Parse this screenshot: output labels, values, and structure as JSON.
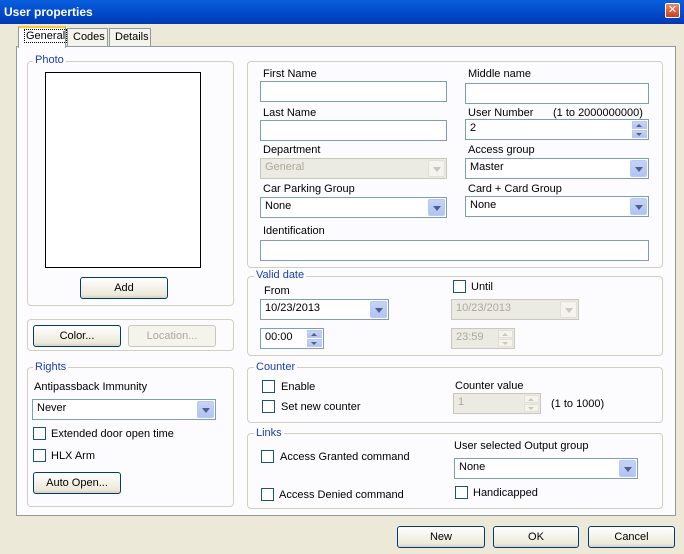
{
  "window": {
    "title": "User properties"
  },
  "tabs": [
    {
      "label": "General"
    },
    {
      "label": "Codes"
    },
    {
      "label": "Details"
    }
  ],
  "photo": {
    "group_label": "Photo",
    "add_button": "Add"
  },
  "buttons": {
    "color": "Color...",
    "location": "Location...",
    "auto_open": "Auto Open...",
    "new": "New",
    "ok": "OK",
    "cancel": "Cancel"
  },
  "rights": {
    "group_label": "Rights",
    "antipassback_label": "Antipassback Immunity",
    "antipassback_value": "Never",
    "extended_door": "Extended door open time",
    "hlx_arm": "HLX Arm"
  },
  "identity": {
    "first_name_label": "First Name",
    "first_name_value": "",
    "middle_name_label": "Middle name",
    "middle_name_value": "",
    "last_name_label": "Last Name",
    "last_name_value": "",
    "user_number_label": "User Number",
    "user_number_range": "(1 to 2000000000)",
    "user_number_value": "2",
    "department_label": "Department",
    "department_value": "General",
    "access_group_label": "Access group",
    "access_group_value": "Master",
    "car_parking_label": "Car Parking Group",
    "car_parking_value": "None",
    "card_group_label": "Card + Card Group",
    "card_group_value": "None",
    "identification_label": "Identification",
    "identification_value": ""
  },
  "valid_date": {
    "group_label": "Valid date",
    "from_label": "From",
    "from_date": "10/23/2013",
    "from_time": "00:00",
    "until_label": "Until",
    "until_date": "10/23/2013",
    "until_time": "23:59"
  },
  "counter": {
    "group_label": "Counter",
    "enable_label": "Enable",
    "set_new_label": "Set new counter",
    "value_label": "Counter value",
    "value": "1",
    "range": "(1 to 1000)"
  },
  "links": {
    "group_label": "Links",
    "granted_label": "Access Granted command",
    "denied_label": "Access Denied command",
    "output_group_label": "User selected Output group",
    "output_group_value": "None",
    "handicapped_label": "Handicapped"
  }
}
